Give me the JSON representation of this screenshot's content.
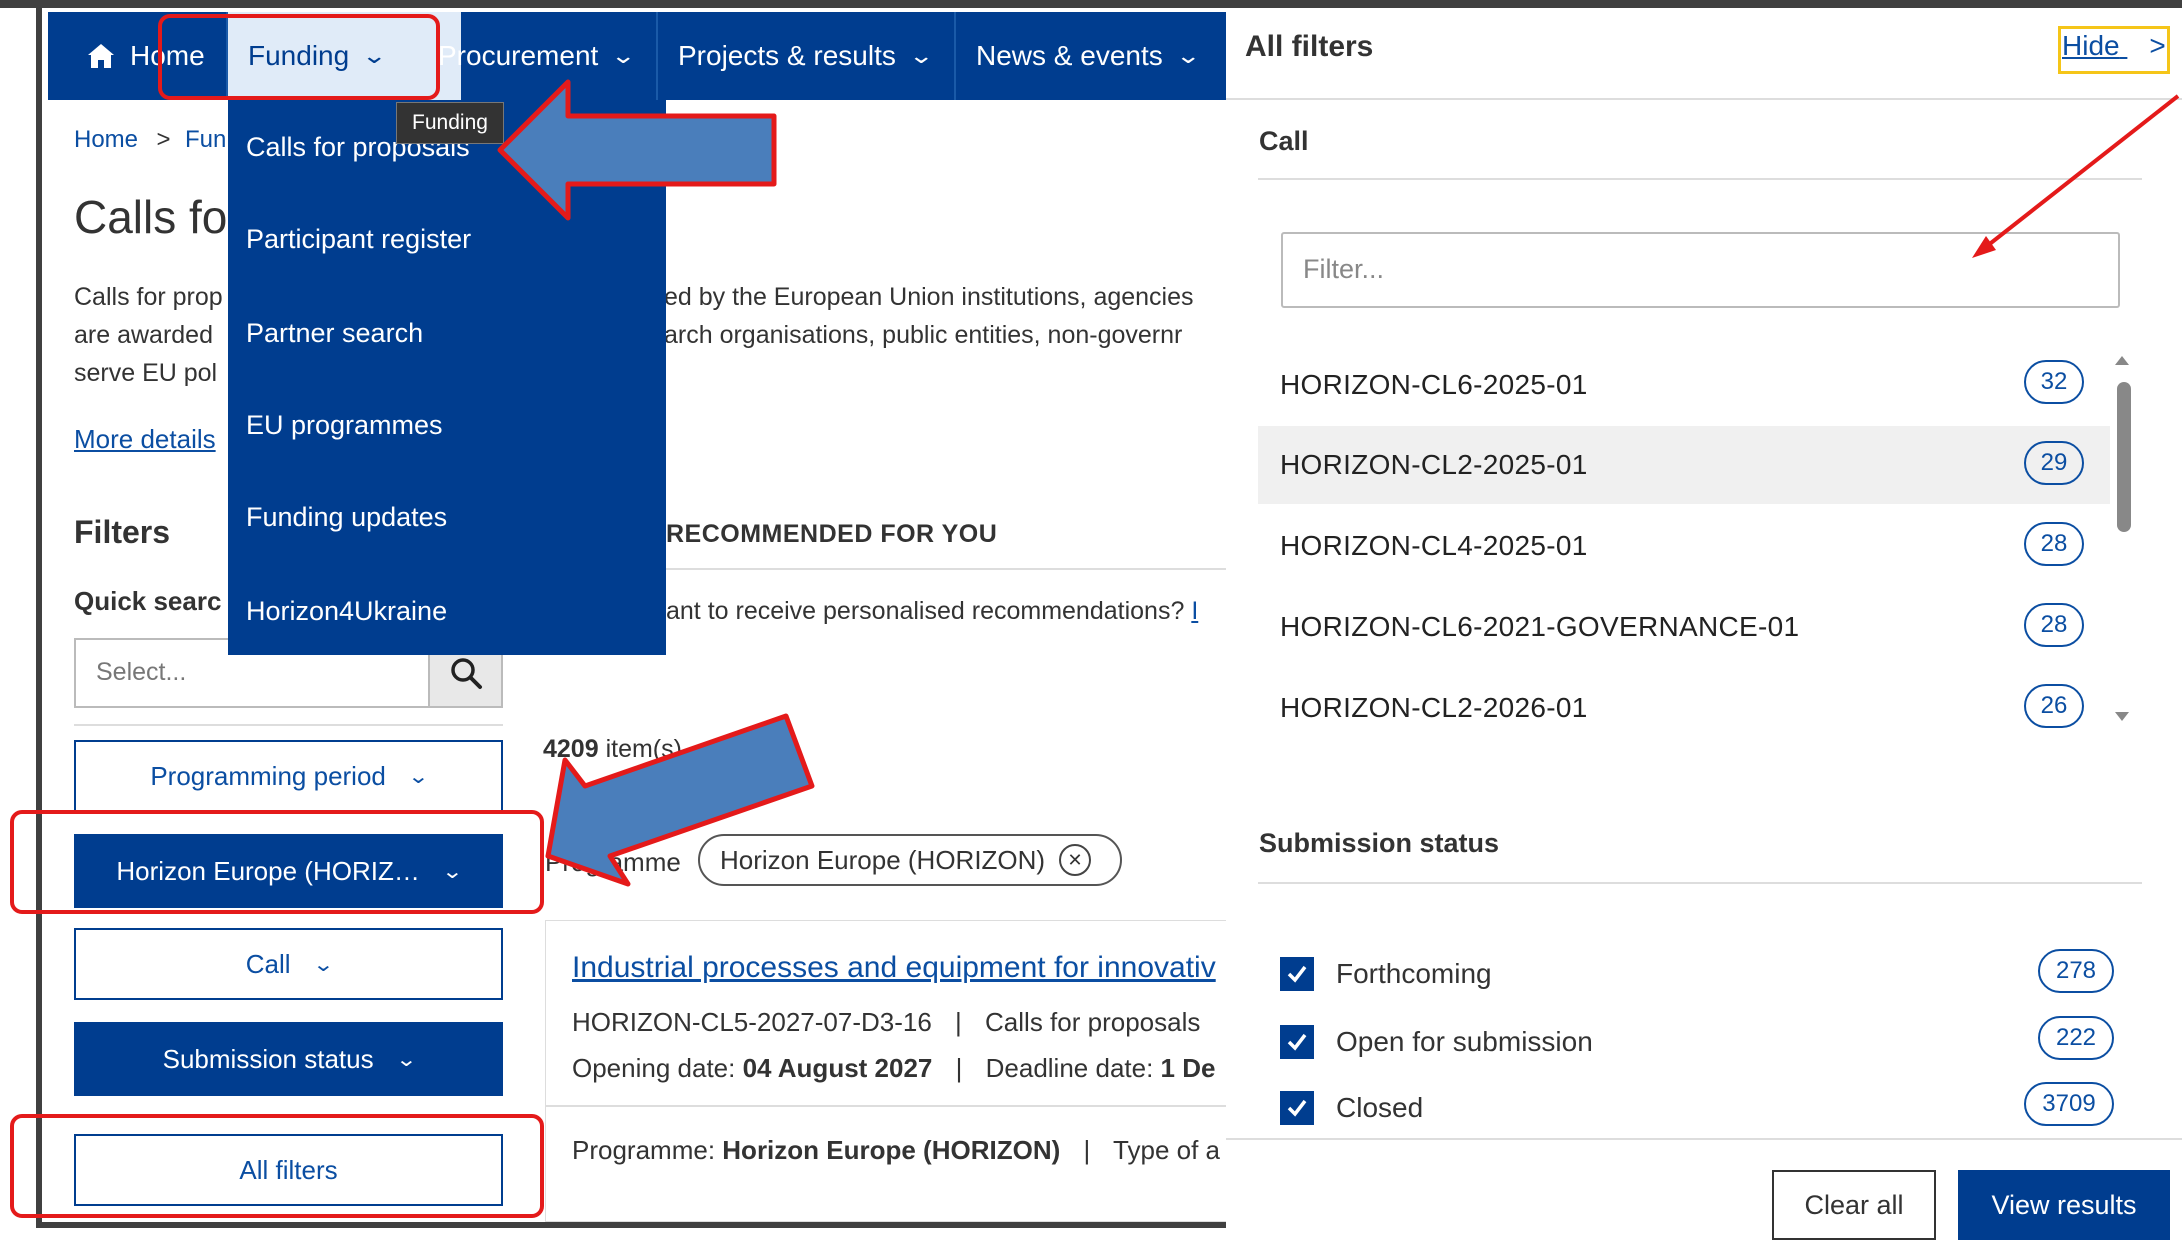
{
  "nav": {
    "home": "Home",
    "funding": "Funding",
    "procurement": "Procurement",
    "projects": "Projects & results",
    "news": "News & events"
  },
  "tooltip": "Funding",
  "dropdown": {
    "items": [
      "Calls for proposals",
      "Participant register",
      "Partner search",
      "EU programmes",
      "Funding updates",
      "Horizon4Ukraine"
    ]
  },
  "breadcrumb": {
    "home": "Home",
    "current": "Fun"
  },
  "page": {
    "title": "Calls fo",
    "intro_line1": "Calls for prop",
    "intro_line2": "are awarded",
    "intro_line3": "serve EU pol",
    "intro_mid1": "ed by the European Union institutions, agencies",
    "intro_mid2": "arch organisations, public entities, non-governr",
    "more_details": "More details"
  },
  "filters": {
    "title": "Filters",
    "quick_search": "Quick searc",
    "select_placeholder": "Select...",
    "programming_period": "Programming period",
    "programme": "Horizon Europe (HORIZ…",
    "call": "Call",
    "submission_status": "Submission status",
    "all_filters": "All filters"
  },
  "recommended": {
    "title": "RECOMMENDED FOR YOU",
    "text": "ant to receive personalised recommendations?",
    "link": "I"
  },
  "results": {
    "count": "4209",
    "count_suffix": "item(s)",
    "chip_label": "Programme",
    "chip_value": "Horizon Europe (HORIZON)"
  },
  "card": {
    "title": "Industrial processes and equipment for innovativ",
    "identifier": "HORIZON-CL5-2027-07-D3-16",
    "sep": "|",
    "type": "Calls for proposals",
    "opening_label": "Opening date:",
    "opening_value": "04 August 2027",
    "deadline_label": "Deadline date:",
    "deadline_value": "1 De",
    "programme_label": "Programme:",
    "programme_value": "Horizon Europe (HORIZON)",
    "type_label": "Type of a"
  },
  "panel": {
    "title": "All filters",
    "hide": "Hide",
    "call_section": "Call",
    "filter_placeholder": "Filter...",
    "calls": [
      {
        "label": "HORIZON-CL6-2025-01",
        "count": "32"
      },
      {
        "label": "HORIZON-CL2-2025-01",
        "count": "29"
      },
      {
        "label": "HORIZON-CL4-2025-01",
        "count": "28"
      },
      {
        "label": "HORIZON-CL6-2021-GOVERNANCE-01",
        "count": "28"
      },
      {
        "label": "HORIZON-CL2-2026-01",
        "count": "26"
      }
    ],
    "submission_section": "Submission status",
    "statuses": [
      {
        "label": "Forthcoming",
        "count": "278",
        "checked": true
      },
      {
        "label": "Open for submission",
        "count": "222",
        "checked": true
      },
      {
        "label": "Closed",
        "count": "3709",
        "checked": true
      }
    ],
    "clear_all": "Clear all",
    "view_results": "View results"
  },
  "colors": {
    "primary": "#003d8f",
    "annotation_red": "#e41a1a",
    "arrow_blue": "#4a7ebb",
    "hide_highlight": "#f5c518"
  }
}
